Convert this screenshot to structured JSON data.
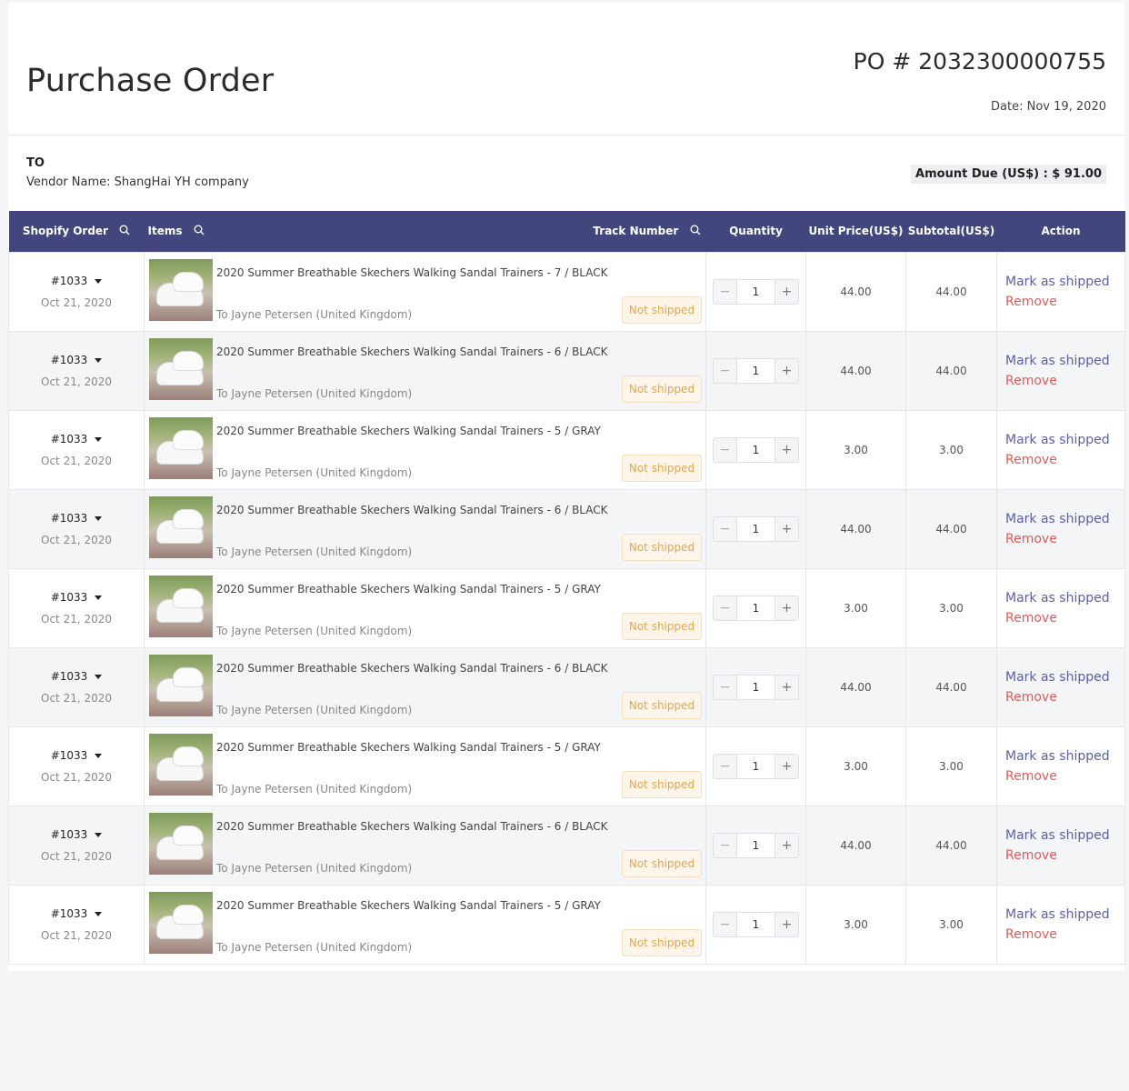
{
  "header": {
    "title": "Purchase Order",
    "po_number": "PO # 2032300000755",
    "date": "Date: Nov 19, 2020"
  },
  "vendor": {
    "to_label": "TO",
    "vendor_name": "Vendor Name: ShangHai YH company",
    "amount_due": "Amount Due (US$) :  $ 91.00"
  },
  "table": {
    "columns": {
      "order": "Shopify Order",
      "items": "Items",
      "track": "Track Number",
      "quantity": "Quantity",
      "unit_price": "Unit Price(US$)",
      "subtotal": "Subtotal(US$)",
      "action": "Action"
    },
    "rows": [
      {
        "order": "#1033",
        "date": "Oct 21, 2020",
        "title": "2020 Summer Breathable Skechers Walking Sandal Trainers - 7 / BLACK",
        "dest": "To Jayne Petersen (United Kingdom)",
        "status": "Not shipped",
        "minus": "−",
        "qty": "1",
        "plus": "+",
        "unit_price": "44.00",
        "subtotal": "44.00",
        "mark": "Mark as shipped",
        "remove": "Remove"
      },
      {
        "order": "#1033",
        "date": "Oct 21, 2020",
        "title": "2020 Summer Breathable Skechers Walking Sandal Trainers - 6 / BLACK",
        "dest": "To Jayne Petersen (United Kingdom)",
        "status": "Not shipped",
        "minus": "−",
        "qty": "1",
        "plus": "+",
        "unit_price": "44.00",
        "subtotal": "44.00",
        "mark": "Mark as shipped",
        "remove": "Remove"
      },
      {
        "order": "#1033",
        "date": "Oct 21, 2020",
        "title": "2020 Summer Breathable Skechers Walking Sandal Trainers - 5 / GRAY",
        "dest": "To Jayne Petersen (United Kingdom)",
        "status": "Not shipped",
        "minus": "−",
        "qty": "1",
        "plus": "+",
        "unit_price": "3.00",
        "subtotal": "3.00",
        "mark": "Mark as shipped",
        "remove": "Remove"
      },
      {
        "order": "#1033",
        "date": "Oct 21, 2020",
        "title": "2020 Summer Breathable Skechers Walking Sandal Trainers - 6 / BLACK",
        "dest": "To Jayne Petersen (United Kingdom)",
        "status": "Not shipped",
        "minus": "−",
        "qty": "1",
        "plus": "+",
        "unit_price": "44.00",
        "subtotal": "44.00",
        "mark": "Mark as shipped",
        "remove": "Remove"
      },
      {
        "order": "#1033",
        "date": "Oct 21, 2020",
        "title": "2020 Summer Breathable Skechers Walking Sandal Trainers - 5 / GRAY",
        "dest": "To Jayne Petersen (United Kingdom)",
        "status": "Not shipped",
        "minus": "−",
        "qty": "1",
        "plus": "+",
        "unit_price": "3.00",
        "subtotal": "3.00",
        "mark": "Mark as shipped",
        "remove": "Remove"
      },
      {
        "order": "#1033",
        "date": "Oct 21, 2020",
        "title": "2020 Summer Breathable Skechers Walking Sandal Trainers - 6 / BLACK",
        "dest": "To Jayne Petersen (United Kingdom)",
        "status": "Not shipped",
        "minus": "−",
        "qty": "1",
        "plus": "+",
        "unit_price": "44.00",
        "subtotal": "44.00",
        "mark": "Mark as shipped",
        "remove": "Remove"
      },
      {
        "order": "#1033",
        "date": "Oct 21, 2020",
        "title": "2020 Summer Breathable Skechers Walking Sandal Trainers - 5 / GRAY",
        "dest": "To Jayne Petersen (United Kingdom)",
        "status": "Not shipped",
        "minus": "−",
        "qty": "1",
        "plus": "+",
        "unit_price": "3.00",
        "subtotal": "3.00",
        "mark": "Mark as shipped",
        "remove": "Remove"
      },
      {
        "order": "#1033",
        "date": "Oct 21, 2020",
        "title": "2020 Summer Breathable Skechers Walking Sandal Trainers - 6 / BLACK",
        "dest": "To Jayne Petersen (United Kingdom)",
        "status": "Not shipped",
        "minus": "−",
        "qty": "1",
        "plus": "+",
        "unit_price": "44.00",
        "subtotal": "44.00",
        "mark": "Mark as shipped",
        "remove": "Remove"
      },
      {
        "order": "#1033",
        "date": "Oct 21, 2020",
        "title": "2020 Summer Breathable Skechers Walking Sandal Trainers - 5 / GRAY",
        "dest": "To Jayne Petersen (United Kingdom)",
        "status": "Not shipped",
        "minus": "−",
        "qty": "1",
        "plus": "+",
        "unit_price": "3.00",
        "subtotal": "3.00",
        "mark": "Mark as shipped",
        "remove": "Remove"
      }
    ]
  },
  "colors": {
    "header_bg": "#43467c",
    "link": "#5b5fa8",
    "danger": "#e05a5a",
    "badge_text": "#e4a652"
  },
  "icons": {
    "column_search": "search-icon",
    "order_dropdown": "caret-down-icon",
    "thumbnail": "product-thumbnail"
  }
}
